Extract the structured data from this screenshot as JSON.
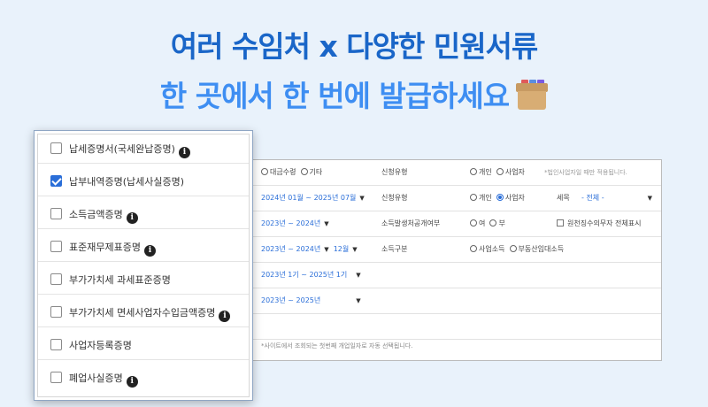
{
  "headline": {
    "line1": "여러 수임처 x 다양한 민원서류",
    "line2": "한 곳에서 한 번에 발급하세요"
  },
  "colors": {
    "primary": "#1a66c8",
    "secondary": "#3e8ef2",
    "checked": "#2a6ed8"
  },
  "icons": {
    "box": "document-box-icon",
    "info": "info-icon"
  },
  "form": {
    "rows": [
      {
        "left": "대금수령",
        "left2": "기타",
        "label": "신청유형",
        "opt1": "개인",
        "opt2": "사업자",
        "hint": "*법인사업자일 때만 적용됩니다."
      },
      {
        "left": "2024년 01월 ~ 2025년 07월",
        "label": "신청유형",
        "opt1": "개인",
        "opt2": "사업자",
        "label2": "세목",
        "select": "- 전체 -"
      },
      {
        "left": "2023년 ~ 2024년",
        "label": "소득발생처공개여부",
        "opt1": "여",
        "opt2": "부",
        "check": "원천징수의무자 전체표시"
      },
      {
        "left": "2023년 ~ 2024년",
        "left2": "12월",
        "label": "소득구분",
        "opt1": "사업소득",
        "opt2": "부동산임대소득"
      },
      {
        "left": "2023년 1기 ~ 2025년 1기"
      },
      {
        "left": "2023년 ~ 2025년"
      }
    ],
    "note": "*사이트에서 조회되는 첫번째 개업일자로 자동 선택됩니다."
  },
  "certificates": [
    {
      "label": "납세증명서(국세완납증명)",
      "checked": false,
      "info": true
    },
    {
      "label": "납부내역증명(납세사실증명)",
      "checked": true,
      "info": false
    },
    {
      "label": "소득금액증명",
      "checked": false,
      "info": true
    },
    {
      "label": "표준재무제표증명",
      "checked": false,
      "info": true
    },
    {
      "label": "부가가치세 과세표준증명",
      "checked": false,
      "info": false
    },
    {
      "label": "부가가치세 면세사업자수입금액증명",
      "checked": false,
      "info": true
    },
    {
      "label": "사업자등록증명",
      "checked": false,
      "info": false
    },
    {
      "label": "폐업사실증명",
      "checked": false,
      "info": true
    }
  ]
}
